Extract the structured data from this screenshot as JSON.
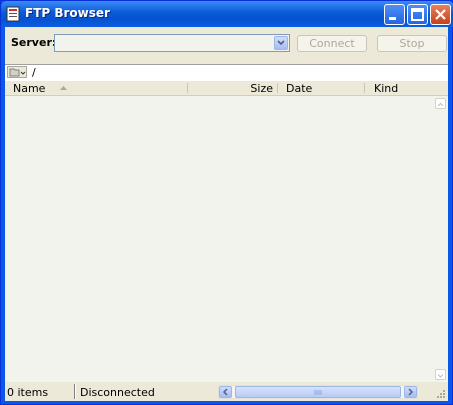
{
  "window": {
    "title": "FTP Browser",
    "icons": {
      "app": "ftp-app-icon",
      "minimize": "minimize-icon",
      "maximize": "maximize-icon",
      "close": "close-icon"
    }
  },
  "toolbar": {
    "server_label": "Server:",
    "server_value": "",
    "connect_label": "Connect",
    "stop_label": "Stop"
  },
  "path": {
    "current": "/"
  },
  "columns": {
    "name": "Name",
    "size": "Size",
    "date": "Date",
    "kind": "Kind"
  },
  "status": {
    "items": "0 items",
    "connection": "Disconnected"
  },
  "colors": {
    "titlebar": "#0a5ad8",
    "face": "#ece9d8",
    "list_bg": "#f3f3ee"
  }
}
